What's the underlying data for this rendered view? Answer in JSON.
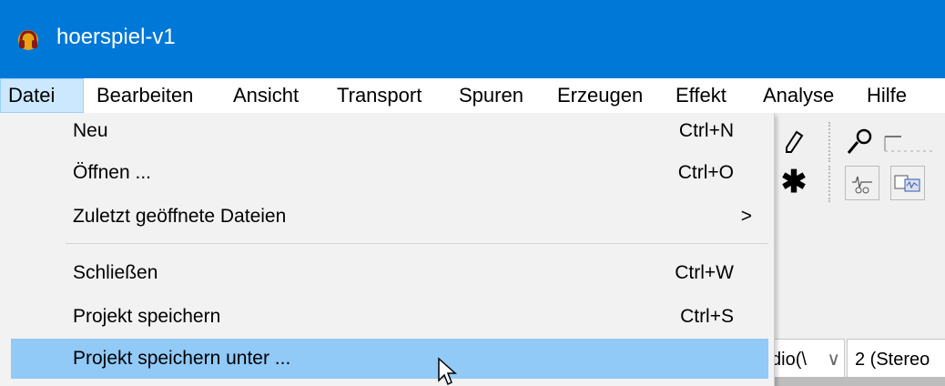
{
  "window": {
    "title": "hoerspiel-v1",
    "icon": "audacity-headphones-icon"
  },
  "menubar": {
    "items": [
      {
        "label": "Datei",
        "active": true
      },
      {
        "label": "Bearbeiten"
      },
      {
        "label": "Ansicht"
      },
      {
        "label": "Transport"
      },
      {
        "label": "Spuren"
      },
      {
        "label": "Erzeugen"
      },
      {
        "label": "Effekt"
      },
      {
        "label": "Analyse"
      },
      {
        "label": "Hilfe"
      }
    ]
  },
  "file_menu": {
    "items": [
      {
        "label": "Neu",
        "shortcut": "Ctrl+N"
      },
      {
        "label": "Öffnen ...",
        "shortcut": "Ctrl+O"
      },
      {
        "label": "Zuletzt geöffnete Dateien",
        "submenu_arrow": ">"
      },
      {
        "label": "Schließen",
        "shortcut": "Ctrl+W"
      },
      {
        "label": "Projekt speichern",
        "shortcut": "Ctrl+S"
      },
      {
        "label": "Projekt speichern unter ...",
        "highlighted": true
      }
    ]
  },
  "background": {
    "host_combo_text": "dio(\\",
    "host_combo_arrow": "∨",
    "channels_combo_text": "2 (Stereo",
    "asterisk": "✱",
    "colors": {
      "titlebar": "#0078d7",
      "menu_highlight": "#91c9f7",
      "menubar_active": "#cce8ff"
    }
  }
}
